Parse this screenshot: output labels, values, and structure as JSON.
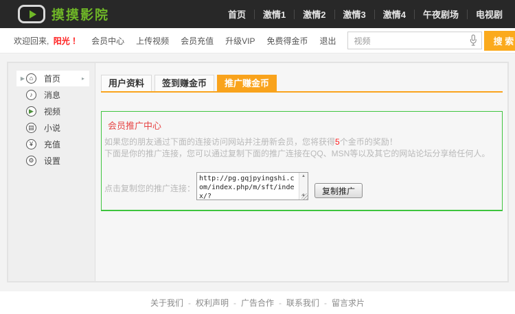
{
  "header": {
    "logo_text": "摸摸影院",
    "nav": [
      "首页",
      "激情1",
      "激情2",
      "激情3",
      "激情4",
      "午夜剧场",
      "电视剧"
    ]
  },
  "userbar": {
    "welcome_prefix": "欢迎回来,",
    "username": "阳光",
    "welcome_suffix": "！",
    "links": [
      "会员中心",
      "上传视频",
      "会员充值",
      "升级VIP",
      "免费得金币",
      "退出"
    ],
    "search": {
      "value": "视频",
      "button_label": "搜 索"
    }
  },
  "sidebar": {
    "items": [
      {
        "label": "首页",
        "icon": "home-icon",
        "glyph": "⌂",
        "active": true
      },
      {
        "label": "消息",
        "icon": "speaker-icon",
        "glyph": "♪",
        "active": false
      },
      {
        "label": "视频",
        "icon": "video-icon",
        "glyph": "▶",
        "active": false
      },
      {
        "label": "小说",
        "icon": "book-icon",
        "glyph": "▤",
        "active": false
      },
      {
        "label": "充值",
        "icon": "coin-icon",
        "glyph": "¥",
        "active": false
      },
      {
        "label": "设置",
        "icon": "gear-icon",
        "glyph": "⚙",
        "active": false
      }
    ]
  },
  "tabs": [
    {
      "label": "用户资料",
      "active": false
    },
    {
      "label": "签到赚金币",
      "active": false
    },
    {
      "label": "推广赚金币",
      "active": true
    }
  ],
  "promo": {
    "title": "会员推广中心",
    "line1_before": "如果您的朋友通过下面的连接访问网站并注册新会员，您将获得",
    "line1_highlight": "5",
    "line1_after": "个金币的奖励！",
    "line2": "下面是你的推广连接，您可以通过复制下面的推广连接在QQ、MSN等以及其它的网站论坛分享给任何人。",
    "copy_label": "点击复制您的推广连接：",
    "link": "http://pg.gqjpyingshi.com/index.php/m/sft/index/?",
    "copy_button": "复制推广",
    "scroll_up_glyph": "▲",
    "scroll_down_glyph": "▼"
  },
  "footer": {
    "links": [
      "关于我们",
      "权利声明",
      "广告合作",
      "联系我们",
      "留言求片"
    ],
    "separator": "-"
  },
  "colors": {
    "topbar_bg": "#282828",
    "brand_green": "#6fb727",
    "accent_orange": "#f9a31c",
    "search_button_orange": "#fbaa1d",
    "panel_border_green": "#3ec43e",
    "alert_red": "#ff1e1e",
    "title_red": "#e64545",
    "muted_text": "#b9b9b9"
  }
}
